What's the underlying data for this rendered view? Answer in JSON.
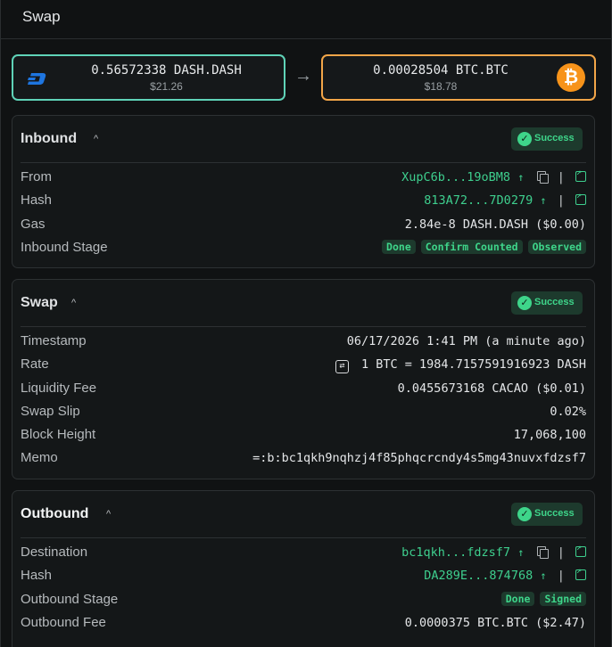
{
  "header": {
    "title": "Swap"
  },
  "assets": {
    "inbound": {
      "amount": "0.56572338 DASH.DASH",
      "usd": "$21.26",
      "icon": "dash-logo-icon"
    },
    "arrow": "→",
    "outbound": {
      "amount": "0.00028504 BTC.BTC",
      "usd": "$18.78",
      "icon": "btc-logo-icon",
      "symbol": "₿"
    }
  },
  "colors": {
    "accent": "#3ecf8e",
    "inbound_border": "#5fd3b8",
    "outbound_border": "#f2a548",
    "btc": "#f7931a",
    "dash": "#1e75e0"
  },
  "inbound": {
    "title": "Inbound",
    "caret": "^",
    "status": "Success",
    "rows": {
      "from": {
        "label": "From",
        "value": "XupC6b...19oBM8"
      },
      "hash": {
        "label": "Hash",
        "value": "813A72...7D0279"
      },
      "gas": {
        "label": "Gas",
        "value": "2.84e-8 DASH.DASH ($0.00)"
      },
      "stage": {
        "label": "Inbound Stage",
        "tags": [
          "Done",
          "Confirm Counted",
          "Observed"
        ]
      }
    }
  },
  "swap": {
    "title": "Swap",
    "caret": "^",
    "status": "Success",
    "rows": {
      "timestamp": {
        "label": "Timestamp",
        "value": "06/17/2026 1:41 PM (a minute ago)"
      },
      "rate": {
        "label": "Rate",
        "value": "1 BTC = 1984.7157591916923 DASH"
      },
      "liquidity_fee": {
        "label": "Liquidity Fee",
        "value": "0.0455673168 CACAO ($0.01)"
      },
      "swap_slip": {
        "label": "Swap Slip",
        "value": "0.02%"
      },
      "block_height": {
        "label": "Block Height",
        "value": "17,068,100"
      },
      "memo": {
        "label": "Memo",
        "value": "=:b:bc1qkh9nqhzj4f85phqcrcndy4s5mg43nuvxfdzsf7"
      }
    }
  },
  "outbound": {
    "title": "Outbound",
    "caret": "^",
    "status": "Success",
    "rows": {
      "destination": {
        "label": "Destination",
        "value": "bc1qkh...fdzsf7"
      },
      "hash": {
        "label": "Hash",
        "value": "DA289E...874768"
      },
      "stage": {
        "label": "Outbound Stage",
        "tags": [
          "Done",
          "Signed"
        ]
      },
      "fee": {
        "label": "Outbound Fee",
        "value": "0.0000375 BTC.BTC ($2.47)"
      }
    }
  },
  "glyphs": {
    "up_arrow": "↑",
    "divider": "|",
    "check": "✓",
    "swap": "⇄"
  }
}
